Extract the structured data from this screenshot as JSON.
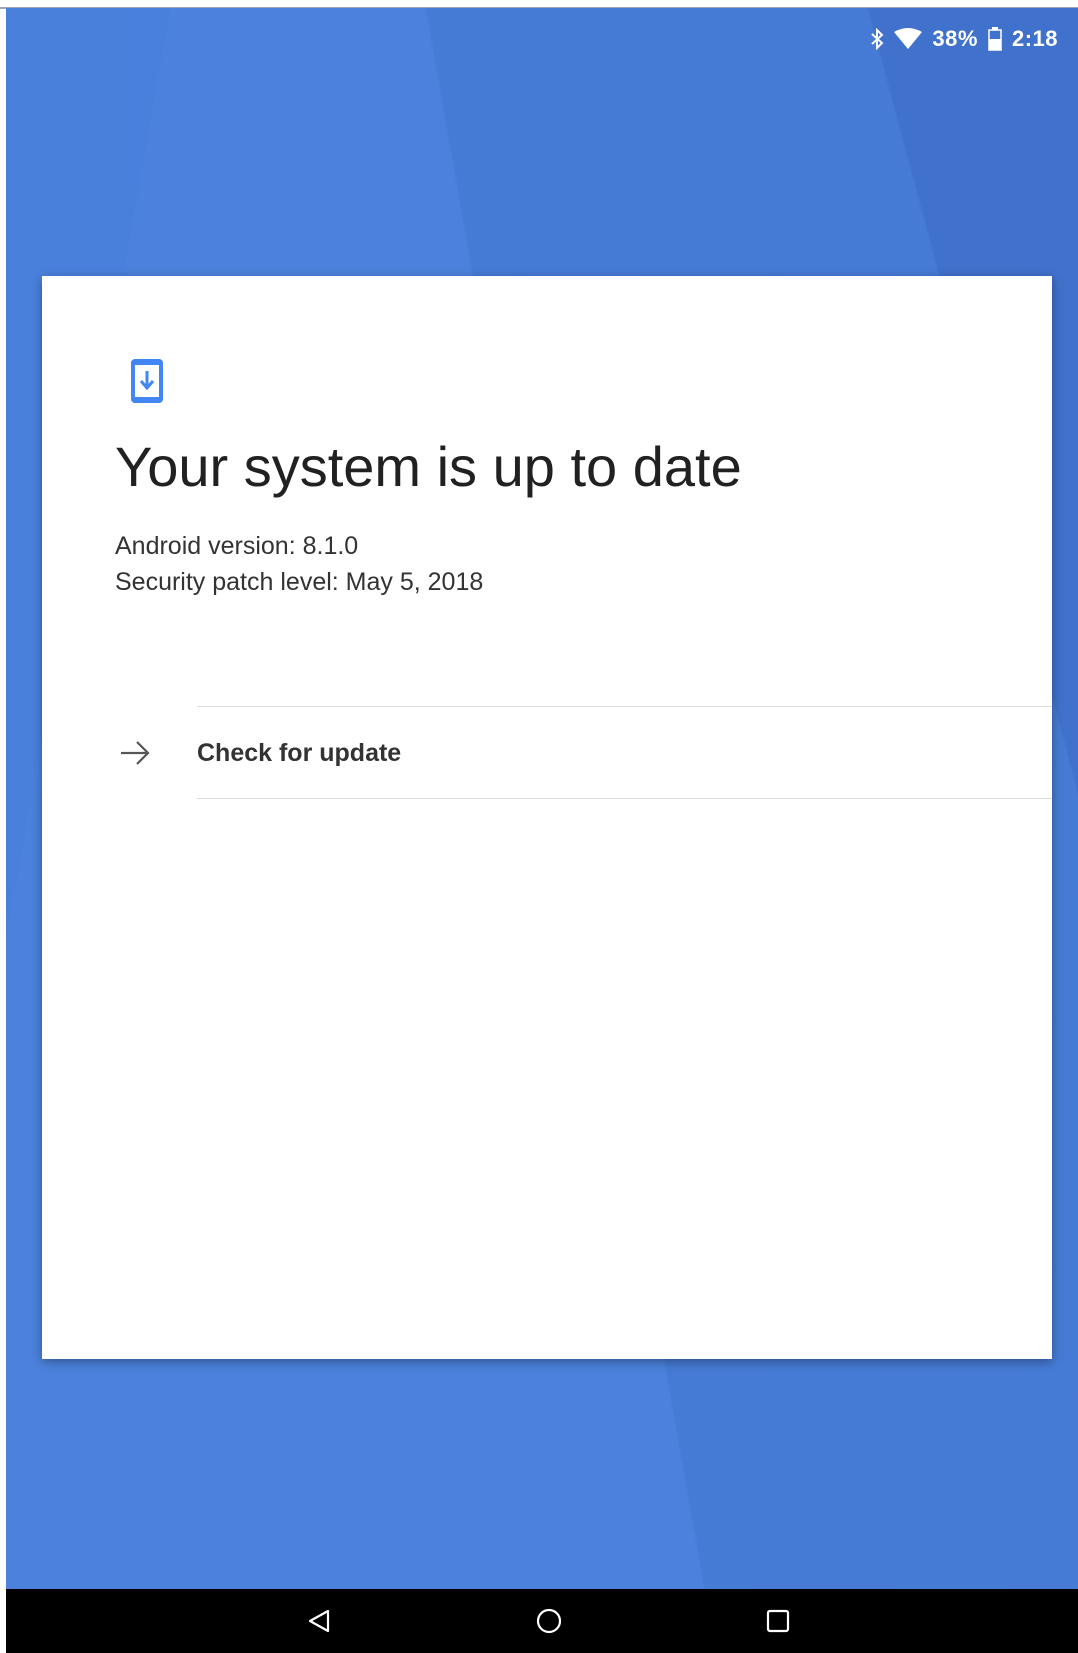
{
  "status_bar": {
    "battery_percent": "38%",
    "time": "2:18",
    "icons": [
      "bluetooth-icon",
      "wifi-icon",
      "battery-icon"
    ]
  },
  "card": {
    "icon": "system-update-icon",
    "title": "Your system is up to date",
    "android_version": "Android version: 8.1.0",
    "security_patch": "Security patch level: May 5, 2018",
    "action": {
      "icon": "arrow-right-icon",
      "label": "Check for update"
    }
  },
  "nav_bar": {
    "buttons": [
      "back-icon",
      "home-icon",
      "recents-icon"
    ]
  },
  "colors": {
    "background": "#4a80dc",
    "card": "#ffffff",
    "accent": "#4285f4",
    "nav_bar": "#000000"
  }
}
